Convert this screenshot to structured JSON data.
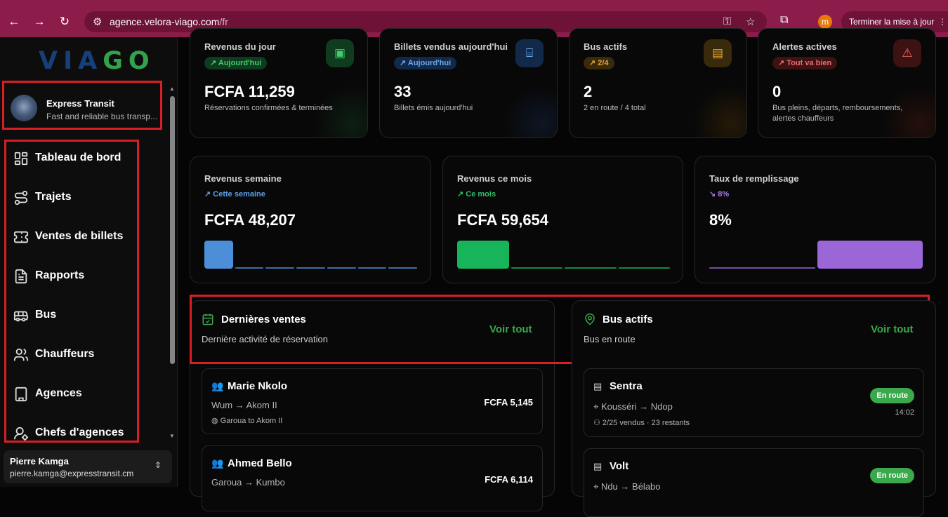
{
  "browser": {
    "url_host": "agence.velora-viago.com",
    "url_path": "/fr",
    "profile_initial": "m",
    "update_label": "Terminer la mise à jour"
  },
  "sidebar": {
    "logo_left": "VIA",
    "logo_right": "GO",
    "agency": {
      "name": "Express Transit",
      "description": "Fast and reliable bus transp..."
    },
    "items": [
      {
        "label": "Tableau de bord",
        "icon": "dashboard-icon"
      },
      {
        "label": "Trajets",
        "icon": "route-icon"
      },
      {
        "label": "Ventes de billets",
        "icon": "ticket-icon"
      },
      {
        "label": "Rapports",
        "icon": "report-icon"
      },
      {
        "label": "Bus",
        "icon": "bus-icon"
      },
      {
        "label": "Chauffeurs",
        "icon": "users-icon"
      },
      {
        "label": "Agences",
        "icon": "building-icon"
      },
      {
        "label": "Chefs d'agences",
        "icon": "user-gear-icon"
      }
    ],
    "user": {
      "name": "Pierre Kamga",
      "email": "pierre.kamga@expresstransit.cm"
    }
  },
  "stats_top": [
    {
      "title": "Revenus du jour",
      "badge": "Aujourd'hui",
      "value": "FCFA 11,259",
      "sub": "Réservations confirmées & terminées",
      "accent": "#3aa84b"
    },
    {
      "title": "Billets vendus aujourd'hui",
      "badge": "Aujourd'hui",
      "value": "33",
      "sub": "Billets émis aujourd'hui",
      "accent": "#4c8fd8"
    },
    {
      "title": "Bus actifs",
      "badge": "2/4",
      "value": "2",
      "sub": "2 en route / 4 total",
      "accent": "#e2a634"
    },
    {
      "title": "Alertes actives",
      "badge": "Tout va bien",
      "value": "0",
      "sub": "Bus pleins, départs, remboursements, alertes chauffeurs",
      "accent": "#e04848"
    }
  ],
  "stats_mid": [
    {
      "title": "Revenus semaine",
      "trend": "Cette semaine",
      "value": "FCFA 48,207",
      "accent": "#4c8fd8",
      "bars": [
        1,
        0,
        0,
        0,
        0,
        0,
        0
      ]
    },
    {
      "title": "Revenus ce mois",
      "trend": "Ce mois",
      "value": "FCFA 59,654",
      "accent": "#17b45a",
      "bars": [
        1,
        0,
        0,
        0
      ]
    },
    {
      "title": "Taux de remplissage",
      "trend": "8%",
      "value": "8%",
      "accent": "#9b66d8",
      "bars": [
        0,
        1
      ]
    }
  ],
  "latest_sales": {
    "title": "Dernières ventes",
    "subtitle": "Dernière activité de réservation",
    "view_all": "Voir tout",
    "rows": [
      {
        "name": "Marie Nkolo",
        "from": "Wum",
        "to": "Akom II",
        "trip": "Garoua to Akom II",
        "price": "FCFA 5,145"
      },
      {
        "name": "Ahmed Bello",
        "from": "Garoua",
        "to": "Kumbo",
        "price": "FCFA 6,114"
      }
    ]
  },
  "active_buses": {
    "title": "Bus actifs",
    "subtitle": "Bus en route",
    "view_all": "Voir tout",
    "rows": [
      {
        "name": "Sentra",
        "from": "Kousséri",
        "to": "Ndop",
        "seats": "2/25 vendus · 23 restants",
        "status": "En route",
        "time": "14:02"
      },
      {
        "name": "Volt",
        "from": "Ndu",
        "to": "Bélabo",
        "status": "En route"
      }
    ]
  }
}
